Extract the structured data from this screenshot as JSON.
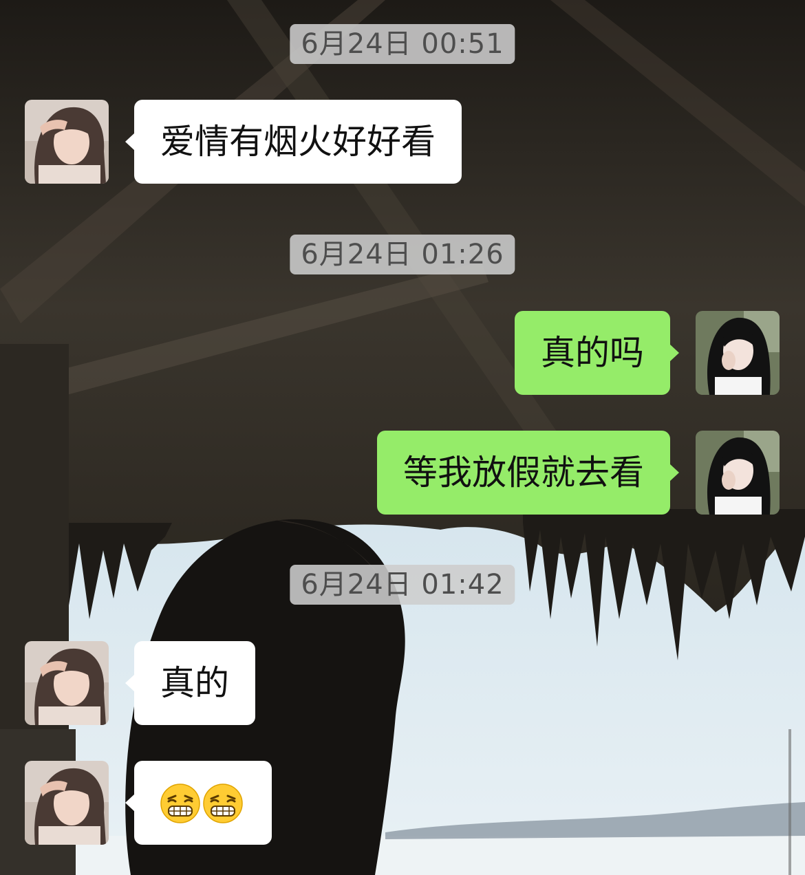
{
  "chat": {
    "messages": [
      {
        "kind": "time",
        "text": "6月24日 00:51"
      },
      {
        "kind": "text",
        "side": "left",
        "text": "爱情有烟火好好看"
      },
      {
        "kind": "time",
        "text": "6月24日 01:26"
      },
      {
        "kind": "text",
        "side": "right",
        "text": "真的吗"
      },
      {
        "kind": "text",
        "side": "right",
        "text": "等我放假就去看"
      },
      {
        "kind": "time",
        "text": "6月24日 01:42"
      },
      {
        "kind": "text",
        "side": "left",
        "text": "真的"
      },
      {
        "kind": "emoji",
        "side": "left",
        "emojis": [
          "grinning-squint-icon",
          "grinning-squint-icon"
        ]
      }
    ]
  },
  "theme": {
    "incoming_bubble": "#ffffff",
    "outgoing_bubble": "#95ec69",
    "timestamp_bg": "#cdcdcd",
    "timestamp_text": "#4e4e4e",
    "message_text": "#111111"
  },
  "avatars": {
    "contact": "avatar-contact-icon",
    "self": "avatar-self-icon"
  }
}
